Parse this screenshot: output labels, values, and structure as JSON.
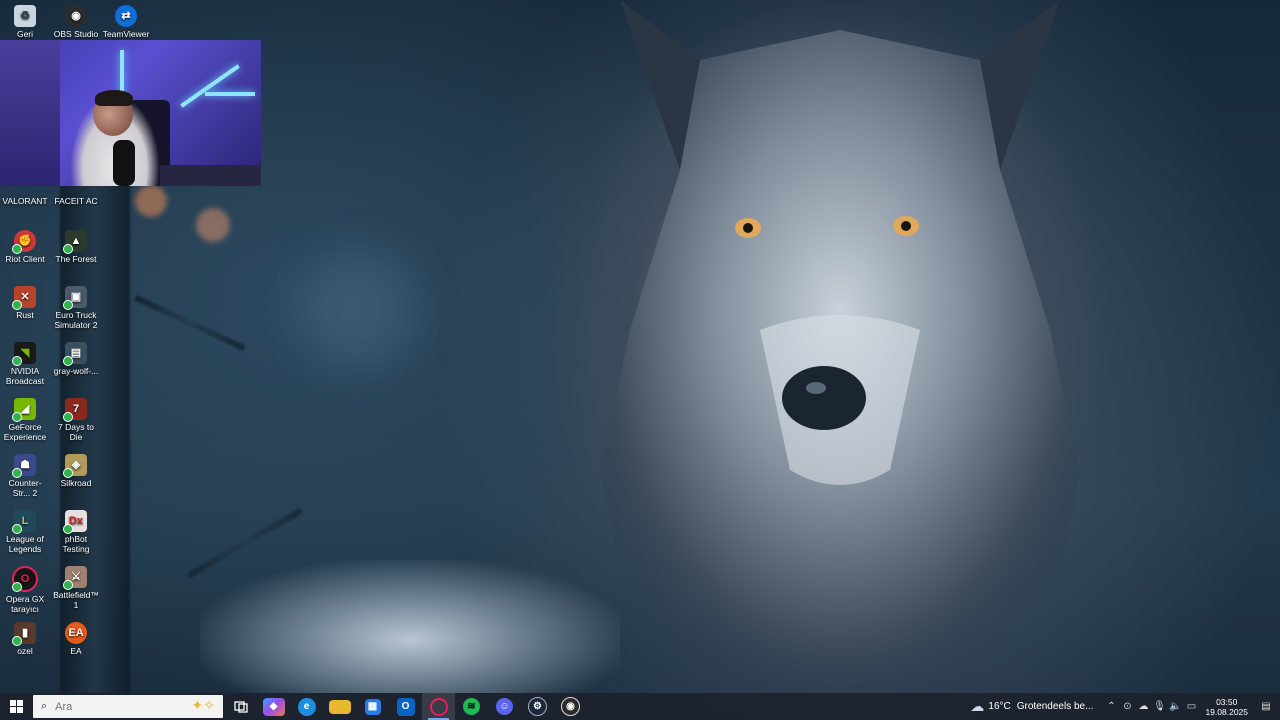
{
  "desktop_icons": [
    {
      "label": "Geri",
      "icon": "recycle-bin-icon",
      "color": "#c9d6e2"
    },
    {
      "label": "OBS Studio",
      "icon": "obs-icon",
      "color": "#2c2c2c"
    },
    {
      "label": "TeamViewer",
      "icon": "teamviewer-icon",
      "color": "#0e6fd8"
    },
    {
      "label": "VALORANT",
      "icon": "valorant-icon",
      "color": "#d03a44"
    },
    {
      "label": "FACEIT AC",
      "icon": "faceit-icon",
      "color": "#222222"
    },
    {
      "label": "Riot Client",
      "icon": "riot-client-icon",
      "color": "#d13639"
    },
    {
      "label": "The Forest",
      "icon": "the-forest-icon",
      "color": "#2b3a2a"
    },
    {
      "label": "Rust",
      "icon": "rust-icon",
      "color": "#b8432a"
    },
    {
      "label": "Euro Truck Simulator 2",
      "icon": "euro-truck-icon",
      "color": "#4a5a6a"
    },
    {
      "label": "NVIDIA Broadcast",
      "icon": "nvidia-broadcast-icon",
      "color": "#1a1a1a"
    },
    {
      "label": "gray-wolf-...",
      "icon": "image-file-icon",
      "color": "#3a5060"
    },
    {
      "label": "GeForce Experience",
      "icon": "geforce-icon",
      "color": "#76b900"
    },
    {
      "label": "7 Days to Die",
      "icon": "7-days-icon",
      "color": "#8a2a1e"
    },
    {
      "label": "Counter-Str... 2",
      "icon": "counter-strike-icon",
      "color": "#3a4a8a"
    },
    {
      "label": "Silkroad",
      "icon": "silkroad-icon",
      "color": "#b09a5a"
    },
    {
      "label": "League of Legends",
      "icon": "league-icon",
      "color": "#1e4a5a"
    },
    {
      "label": "phBot Testing",
      "icon": "phbot-icon",
      "color": "#e8e0e0"
    },
    {
      "label": "Opera GX tarayıcı",
      "icon": "opera-gx-icon",
      "color": "#151515"
    },
    {
      "label": "Battlefield™ 1",
      "icon": "battlefield-icon",
      "color": "#a08070"
    },
    {
      "label": "ozel",
      "icon": "folder-icon",
      "color": "#5a3a2a"
    },
    {
      "label": "EA",
      "icon": "ea-icon",
      "color": "#e85a1a"
    }
  ],
  "taskbar": {
    "search_placeholder": "Ara",
    "apps": [
      {
        "name": "task-view",
        "color": "#ffffff"
      },
      {
        "name": "copilot",
        "color": "#7a5ae8"
      },
      {
        "name": "edge",
        "color": "#1b8fe0"
      },
      {
        "name": "file-explorer",
        "color": "#e8b830"
      },
      {
        "name": "store",
        "color": "#2a7ae8"
      },
      {
        "name": "outlook",
        "color": "#0a64c8"
      },
      {
        "name": "opera-gx",
        "color": "#e8205a"
      },
      {
        "name": "spotify",
        "color": "#1db954"
      },
      {
        "name": "discord",
        "color": "#5865f2"
      },
      {
        "name": "steam",
        "color": "#1b2838"
      },
      {
        "name": "obs",
        "color": "#2c2c2c"
      }
    ],
    "weather_temp": "16°C",
    "weather_text": "Grotendeels be...",
    "time": "03:50",
    "date": "19.08.2025"
  }
}
